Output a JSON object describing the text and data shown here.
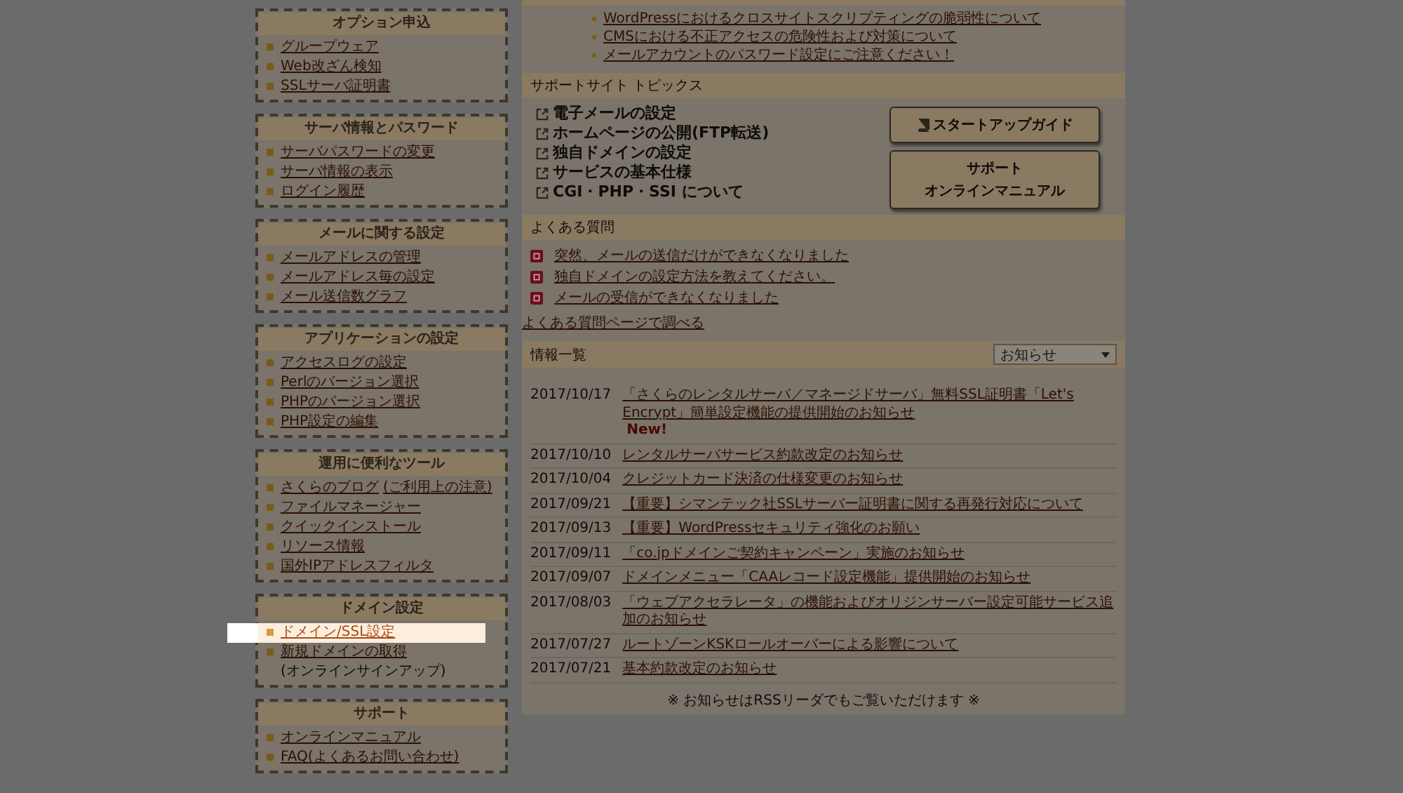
{
  "sidebar": {
    "sections": [
      {
        "title": "オプション申込",
        "items": [
          {
            "label": "グループウェア",
            "highlighted": false
          },
          {
            "label": "Web改ざん検知",
            "highlighted": false
          },
          {
            "label": "SSLサーバ証明書",
            "highlighted": false
          }
        ]
      },
      {
        "title": "サーバ情報とパスワード",
        "items": [
          {
            "label": "サーバパスワードの変更",
            "highlighted": false
          },
          {
            "label": "サーバ情報の表示",
            "highlighted": false
          },
          {
            "label": "ログイン履歴",
            "highlighted": false
          }
        ]
      },
      {
        "title": "メールに関する設定",
        "items": [
          {
            "label": "メールアドレスの管理",
            "highlighted": false
          },
          {
            "label": "メールアドレス毎の設定",
            "highlighted": false
          },
          {
            "label": "メール送信数グラフ",
            "highlighted": false
          }
        ]
      },
      {
        "title": "アプリケーションの設定",
        "items": [
          {
            "label": "アクセスログの設定",
            "highlighted": false
          },
          {
            "label": "Perlのバージョン選択",
            "highlighted": false
          },
          {
            "label": "PHPのバージョン選択",
            "highlighted": false
          },
          {
            "label": "PHP設定の編集",
            "highlighted": false
          }
        ]
      },
      {
        "title": "運用に便利なツール",
        "items": [
          {
            "label": "さくらのブログ",
            "note": "(ご利用上の注意)",
            "highlighted": false
          },
          {
            "label": "ファイルマネージャー",
            "highlighted": false
          },
          {
            "label": "クイックインストール",
            "highlighted": false
          },
          {
            "label": "リソース情報",
            "highlighted": false
          },
          {
            "label": "国外IPアドレスフィルタ",
            "highlighted": false
          }
        ]
      },
      {
        "title": "ドメイン設定",
        "items": [
          {
            "label": "ドメイン/SSL設定",
            "highlighted": true
          },
          {
            "label": "新規ドメインの取得",
            "sub": "(オンラインサインアップ)",
            "highlighted": false
          }
        ]
      },
      {
        "title": "サポート",
        "items": [
          {
            "label": "オンラインマニュアル",
            "highlighted": false
          },
          {
            "label": "FAQ(よくあるお問い合わせ)",
            "highlighted": false
          }
        ]
      }
    ]
  },
  "notices": [
    "WordPressにおけるクロスサイトスクリプティングの脆弱性について",
    "CMSにおける不正アクセスの危険性および対策について",
    "メールアカウントのパスワード設定にご注意ください！"
  ],
  "support_topics": {
    "title": "サポートサイト トピックス",
    "links": [
      "電子メールの設定",
      "ホームページの公開(FTP転送)",
      "独自ドメインの設定",
      "サービスの基本仕様",
      "CGI・PHP・SSI について"
    ],
    "buttons": [
      {
        "kind": "guide",
        "lines": [
          "スタートアップガイド"
        ]
      },
      {
        "kind": "manual",
        "lines": [
          "サポート",
          "オンラインマニュアル"
        ]
      }
    ]
  },
  "faq": {
    "title": "よくある質問",
    "items": [
      "突然、メールの送信だけができなくなりました",
      "独自ドメインの設定方法を教えてください。",
      "メールの受信ができなくなりました"
    ],
    "more_link": "よくある質問ページで調べる"
  },
  "news": {
    "title": "情報一覧",
    "filter": "お知らせ",
    "items": [
      {
        "date": "2017/10/17",
        "title": "「さくらのレンタルサーバ／マネージドサーバ」無料SSL証明書「Let's Encrypt」簡単設定機能の提供開始のお知らせ",
        "badge": "New!"
      },
      {
        "date": "2017/10/10",
        "title": "レンタルサーバサービス約款改定のお知らせ"
      },
      {
        "date": "2017/10/04",
        "title": "クレジットカード決済の仕様変更のお知らせ"
      },
      {
        "date": "2017/09/21",
        "title": "【重要】シマンテック社SSLサーバー証明書に関する再発行対応について"
      },
      {
        "date": "2017/09/13",
        "title": "【重要】WordPressセキュリティ強化のお願い"
      },
      {
        "date": "2017/09/11",
        "title": "「co.jpドメインご契約キャンペーン」実施のお知らせ"
      },
      {
        "date": "2017/09/07",
        "title": "ドメインメニュー「CAAレコード設定機能」提供開始のお知らせ"
      },
      {
        "date": "2017/08/03",
        "title": "「ウェブアクセラレータ」の機能およびオリジンサーバー設定可能サービス追加のお知らせ"
      },
      {
        "date": "2017/07/27",
        "title": "ルートゾーンKSKロールオーバーによる影響について"
      },
      {
        "date": "2017/07/21",
        "title": "基本約款改定のお知らせ"
      }
    ],
    "footer": "※ お知らせはRSSリーダでもご覧いただけます ※"
  }
}
